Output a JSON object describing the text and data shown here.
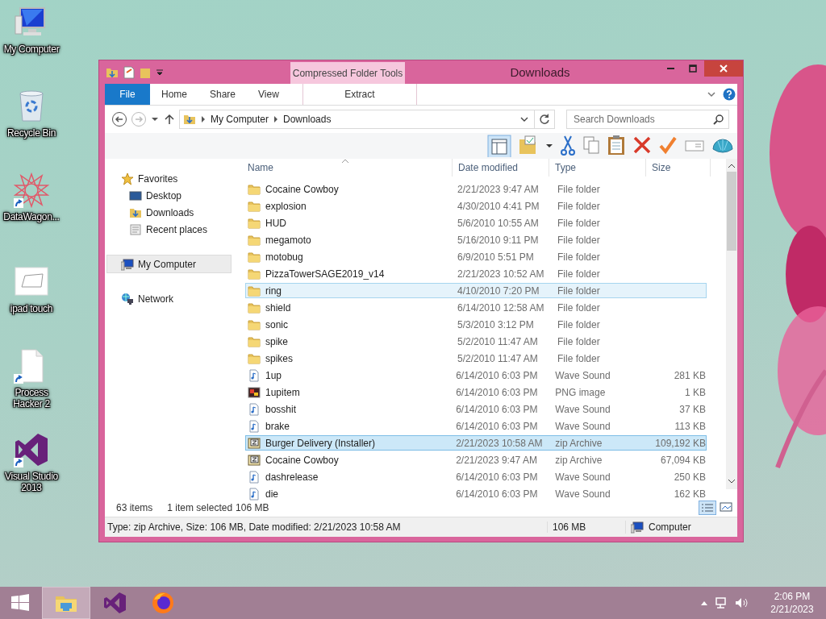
{
  "desktop_icons": [
    {
      "label": "My Computer",
      "kind": "computer",
      "shortcut": false
    },
    {
      "label": "Recycle Bin",
      "kind": "bin",
      "shortcut": false
    },
    {
      "label": "DataWagon...",
      "kind": "star",
      "shortcut": true
    },
    {
      "label": "ipad touch",
      "kind": "sketch",
      "shortcut": false
    },
    {
      "label": "Process Hacker 2",
      "kind": "blank",
      "shortcut": true
    },
    {
      "label": "Visual Studio 2013",
      "kind": "vs",
      "shortcut": true
    }
  ],
  "window": {
    "title": "Downloads",
    "contextual_group": "Compressed Folder Tools",
    "ribbon_tabs": [
      {
        "label": "File",
        "kind": "file",
        "selected": false
      },
      {
        "label": "Home",
        "kind": "plain",
        "selected": false
      },
      {
        "label": "Share",
        "kind": "plain",
        "selected": false
      },
      {
        "label": "View",
        "kind": "plain",
        "selected": false
      },
      {
        "label": "Extract",
        "kind": "contextual",
        "selected": false
      }
    ],
    "address": {
      "path": [
        "My Computer",
        "Downloads"
      ]
    },
    "search": {
      "placeholder": "Search Downloads"
    },
    "nav": [
      {
        "label": "Favorites",
        "kind": "star",
        "selected": false,
        "children": [
          {
            "label": "Desktop",
            "kind": "desktop",
            "selected": false
          },
          {
            "label": "Downloads",
            "kind": "downloads",
            "selected": false
          },
          {
            "label": "Recent places",
            "kind": "recent",
            "selected": false
          }
        ]
      },
      {
        "label": "My Computer",
        "kind": "computer",
        "selected": true
      },
      {
        "label": "Network",
        "kind": "network",
        "selected": false
      }
    ],
    "columns": [
      "Name",
      "Date modified",
      "Type",
      "Size"
    ],
    "rows": [
      {
        "name": "Cocaine Cowboy",
        "date": "2/21/2023 9:47 AM",
        "type": "File folder",
        "kind": "folder",
        "selected": false,
        "hovered": false
      },
      {
        "name": "explosion",
        "date": "4/30/2010 4:41 PM",
        "type": "File folder",
        "kind": "folder",
        "selected": false,
        "hovered": false
      },
      {
        "name": "HUD",
        "date": "5/6/2010 10:55 AM",
        "type": "File folder",
        "kind": "folder",
        "selected": false,
        "hovered": false
      },
      {
        "name": "megamoto",
        "date": "5/16/2010 9:11 PM",
        "type": "File folder",
        "kind": "folder",
        "selected": false,
        "hovered": false
      },
      {
        "name": "motobug",
        "date": "6/9/2010 5:51 PM",
        "type": "File folder",
        "kind": "folder",
        "selected": false,
        "hovered": false
      },
      {
        "name": "PizzaTowerSAGE2019_v14",
        "date": "2/21/2023 10:52 AM",
        "type": "File folder",
        "kind": "folder",
        "selected": false,
        "hovered": false
      },
      {
        "name": "ring",
        "date": "4/10/2010 7:20 PM",
        "type": "File folder",
        "kind": "folder",
        "selected": false,
        "hovered": true
      },
      {
        "name": "shield",
        "date": "6/14/2010 12:58 AM",
        "type": "File folder",
        "kind": "folder",
        "selected": false,
        "hovered": false
      },
      {
        "name": "sonic",
        "date": "5/3/2010 3:12 PM",
        "type": "File folder",
        "kind": "folder",
        "selected": false,
        "hovered": false
      },
      {
        "name": "spike",
        "date": "5/2/2010 11:47 AM",
        "type": "File folder",
        "kind": "folder",
        "selected": false,
        "hovered": false
      },
      {
        "name": "spikes",
        "date": "5/2/2010 11:47 AM",
        "type": "File folder",
        "kind": "folder",
        "selected": false,
        "hovered": false
      },
      {
        "name": "1up",
        "date": "6/14/2010 6:03 PM",
        "type": "Wave Sound",
        "size": "281 KB",
        "kind": "wave",
        "selected": false,
        "hovered": false
      },
      {
        "name": "1upitem",
        "date": "6/14/2010 6:03 PM",
        "type": "PNG image",
        "size": "1 KB",
        "kind": "image",
        "selected": false,
        "hovered": false
      },
      {
        "name": "bosshit",
        "date": "6/14/2010 6:03 PM",
        "type": "Wave Sound",
        "size": "37 KB",
        "kind": "wave",
        "selected": false,
        "hovered": false
      },
      {
        "name": "brake",
        "date": "6/14/2010 6:03 PM",
        "type": "Wave Sound",
        "size": "113 KB",
        "kind": "wave",
        "selected": false,
        "hovered": false
      },
      {
        "name": "Burger Delivery (Installer)",
        "date": "2/21/2023 10:58 AM",
        "type": "zip Archive",
        "size": "109,192 KB",
        "kind": "zip",
        "selected": true,
        "hovered": false
      },
      {
        "name": "Cocaine Cowboy",
        "date": "2/21/2023 9:47 AM",
        "type": "zip Archive",
        "size": "67,094 KB",
        "kind": "zip",
        "selected": false,
        "hovered": false
      },
      {
        "name": "dashrelease",
        "date": "6/14/2010 6:03 PM",
        "type": "Wave Sound",
        "size": "250 KB",
        "kind": "wave",
        "selected": false,
        "hovered": false
      },
      {
        "name": "die",
        "date": "6/14/2010 6:03 PM",
        "type": "Wave Sound",
        "size": "162 KB",
        "kind": "wave",
        "selected": false,
        "hovered": false
      }
    ],
    "status": {
      "item_count": "63 items",
      "selection": "1 item selected",
      "selection_size": "106 MB"
    },
    "details_bar": {
      "text": "Type: zip Archive, Size: 106 MB, Date modified: 2/21/2023 10:58 AM",
      "size": "106 MB",
      "location": "Computer"
    }
  },
  "taskbar": {
    "apps": [
      {
        "kind": "explorer",
        "selected": true
      },
      {
        "kind": "vs",
        "selected": false
      },
      {
        "kind": "firefox",
        "selected": false
      }
    ],
    "time": "2:06 PM",
    "date": "2/21/2023"
  }
}
